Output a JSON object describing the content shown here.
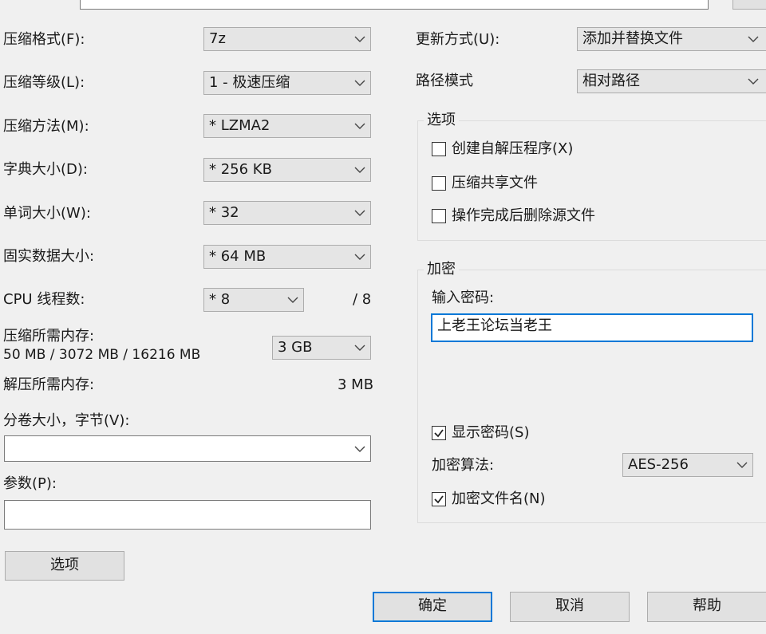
{
  "left": {
    "format_label": "压缩格式(F):",
    "format_value": "7z",
    "level_label": "压缩等级(L):",
    "level_value": "1 - 极速压缩",
    "method_label": "压缩方法(M):",
    "method_value": "* LZMA2",
    "dict_label": "字典大小(D):",
    "dict_value": "* 256 KB",
    "word_label": "单词大小(W):",
    "word_value": "* 32",
    "solid_label": "固实数据大小:",
    "solid_value": "* 64 MB",
    "threads_label": "CPU 线程数:",
    "threads_value": "* 8",
    "threads_max": "/ 8",
    "mem_compress_label": "压缩所需内存:",
    "mem_compress_detail": "50 MB / 3072 MB / 16216 MB",
    "mem_compress_value": "3 GB",
    "mem_decompress_label": "解压所需内存:",
    "mem_decompress_value": "3 MB",
    "volume_label": "分卷大小，字节(V):",
    "volume_value": "",
    "params_label": "参数(P):",
    "params_value": "",
    "options_button": "选项"
  },
  "right": {
    "update_label": "更新方式(U):",
    "update_value": "添加并替换文件",
    "path_label": "路径模式",
    "path_value": "相对路径",
    "options_group": {
      "title": "选项",
      "sfx_label": "创建自解压程序(X)",
      "sfx_checked": false,
      "shared_label": "压缩共享文件",
      "shared_checked": false,
      "delete_label": "操作完成后删除源文件",
      "delete_checked": false
    },
    "encrypt_group": {
      "title": "加密",
      "password_label": "输入密码:",
      "password_value": "上老王论坛当老王",
      "show_password_label": "显示密码(S)",
      "show_password_checked": true,
      "method_label": "加密算法:",
      "method_value": "AES-256",
      "encrypt_names_label": "加密文件名(N)",
      "encrypt_names_checked": true
    }
  },
  "buttons": {
    "ok": "确定",
    "cancel": "取消",
    "help": "帮助"
  },
  "colors": {
    "focus_border": "#0078d7",
    "dialog_bg": "#f0f0f0"
  }
}
